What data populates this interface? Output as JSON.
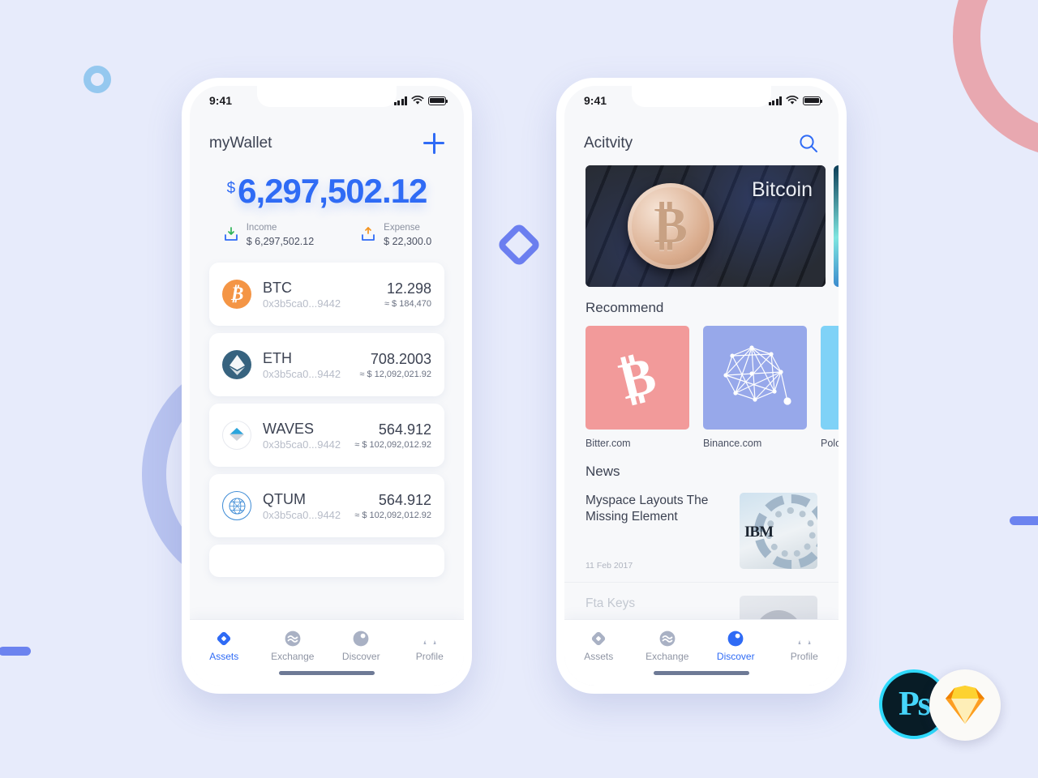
{
  "meta": {
    "bg_color": "#e7ebfb",
    "accent_blue": "#2f6bf5",
    "muted_text": "#8b91a0"
  },
  "decor": {
    "ring_pink": "pink-ring-arc",
    "ring_blue_small": "small-blue-ring",
    "ring_purple_large": "large-purple-ring",
    "bar_left": "left-blue-bar",
    "bar_right": "right-blue-bar",
    "diamond": "blue-diamond-outline",
    "badge_ps_label": "Ps",
    "badge_sketch_label": "sketch-diamond-icon"
  },
  "phone1": {
    "status": {
      "time": "9:41",
      "signal": "signal-bars-icon",
      "wifi": "wifi-icon",
      "battery": "battery-icon"
    },
    "header": {
      "title": "myWallet",
      "add_button": "+"
    },
    "balance": {
      "currency_symbol": "$",
      "amount": "6,297,502.12",
      "income": {
        "label": "Income",
        "value": "$ 6,297,502.12",
        "icon": "income-tray-down-icon"
      },
      "expense": {
        "label": "Expense",
        "value": "$ 22,300.0",
        "icon": "expense-tray-up-icon"
      }
    },
    "assets": [
      {
        "symbol": "BTC",
        "address": "0x3b5ca0...9442",
        "qty": "12.298",
        "usd": "≈ $ 184,470",
        "icon": "bitcoin-icon",
        "icon_bg": "#f49545",
        "icon_fg": "#ffffff"
      },
      {
        "symbol": "ETH",
        "address": "0x3b5ca0...9442",
        "qty": "708.2003",
        "usd": "≈ $ 12,092,021.92",
        "icon": "ethereum-icon",
        "icon_bg": "#37637f",
        "icon_fg": "#ffffff"
      },
      {
        "symbol": "WAVES",
        "address": "0x3b5ca0...9442",
        "qty": "564.912",
        "usd": "≈ $ 102,092,012.92",
        "icon": "waves-icon",
        "icon_bg": "#ffffff",
        "icon_fg": "#29a5dd"
      },
      {
        "symbol": "QTUM",
        "address": "0x3b5ca0...9442",
        "qty": "564.912",
        "usd": "≈ $ 102,092,012.92",
        "icon": "qtum-icon",
        "icon_bg": "#ffffff",
        "icon_fg": "#3f8cd6"
      }
    ],
    "tabs": [
      {
        "label": "Assets",
        "icon": "assets-diamond-icon",
        "active": true
      },
      {
        "label": "Exchange",
        "icon": "exchange-wave-icon",
        "active": false
      },
      {
        "label": "Discover",
        "icon": "discover-compass-icon",
        "active": false
      },
      {
        "label": "Profile",
        "icon": "profile-person-icon",
        "active": false
      }
    ]
  },
  "phone2": {
    "status": {
      "time": "9:41",
      "signal": "signal-bars-icon",
      "wifi": "wifi-icon",
      "battery": "battery-icon"
    },
    "header": {
      "title": "Acitvity",
      "search_icon": "search-icon"
    },
    "banners": [
      {
        "caption": "Bitcoin",
        "image": "bitcoin-coin-on-keyboard-photo"
      },
      {
        "caption": "",
        "image": "abstract-blue-photo"
      }
    ],
    "recommend": {
      "title": "Recommend",
      "items": [
        {
          "label": "Bitter.com",
          "tile_color": "#f29a9a",
          "icon": "bitcoin-b-icon"
        },
        {
          "label": "Binance.com",
          "tile_color": "#97a8ea",
          "icon": "binance-network-icon"
        },
        {
          "label": "Polonie",
          "tile_color": "#7fd2f7",
          "icon": "poloniex-icon"
        }
      ]
    },
    "news": {
      "title": "News",
      "items": [
        {
          "title": "Myspace Layouts The Missing Element",
          "date": "11 Feb 2017",
          "thumb": "ibm-server-photo"
        },
        {
          "title": "Fta Keys",
          "date": "",
          "thumb": "person-avatar-photo"
        }
      ]
    },
    "tabs": [
      {
        "label": "Assets",
        "icon": "assets-diamond-icon",
        "active": false
      },
      {
        "label": "Exchange",
        "icon": "exchange-wave-icon",
        "active": false
      },
      {
        "label": "Discover",
        "icon": "discover-compass-icon",
        "active": true
      },
      {
        "label": "Profile",
        "icon": "profile-person-icon",
        "active": false
      }
    ]
  }
}
